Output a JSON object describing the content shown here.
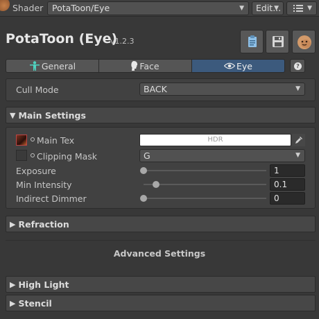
{
  "topbar": {
    "shader_label": "Shader",
    "shader_value": "PotaToon/Eye",
    "edit_label": "Edit..."
  },
  "header": {
    "title": "PotaToon (Eye)",
    "version": "v1.2.3"
  },
  "tabs": [
    {
      "label": "General",
      "active": false
    },
    {
      "label": "Face",
      "active": false
    },
    {
      "label": "Eye",
      "active": true
    }
  ],
  "help_label": "?",
  "cull": {
    "label": "Cull Mode",
    "value": "BACK"
  },
  "main_settings": {
    "title": "Main Settings",
    "main_tex": {
      "label": "Main Tex",
      "value": "HDR"
    },
    "clipping_mask": {
      "label": "Clipping Mask",
      "value": "G"
    },
    "exposure": {
      "label": "Exposure",
      "value": "1",
      "fraction": 0.0
    },
    "min_intensity": {
      "label": "Min Intensity",
      "value": "0.1",
      "fraction": 0.1
    },
    "indirect_dimmer": {
      "label": "Indirect Dimmer",
      "value": "0",
      "fraction": 0.0
    }
  },
  "sections": {
    "refraction": "Refraction",
    "advanced": "Advanced Settings",
    "high_light": "High Light",
    "stencil": "Stencil"
  },
  "colors": {
    "active_tab": "#3c5a7d",
    "background": "#383838"
  }
}
